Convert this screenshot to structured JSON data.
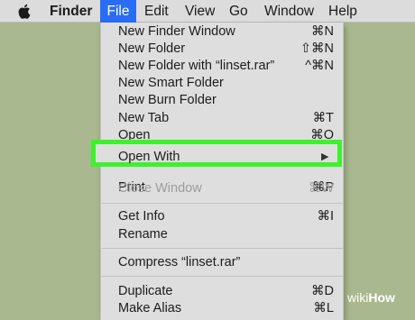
{
  "menubar": {
    "items": [
      "Finder",
      "File",
      "Edit",
      "View",
      "Go",
      "Window",
      "Help"
    ]
  },
  "file_menu": {
    "items": [
      {
        "label": "New Finder Window",
        "shortcut": "⌘N"
      },
      {
        "label": "New Folder",
        "shortcut": "⇧⌘N"
      },
      {
        "label": "New Folder with “linset.rar”",
        "shortcut": "^⌘N"
      },
      {
        "label": "New Smart Folder",
        "shortcut": ""
      },
      {
        "label": "New Burn Folder",
        "shortcut": ""
      },
      {
        "label": "New Tab",
        "shortcut": "⌘T"
      },
      {
        "label": "Open",
        "shortcut": "⌘O"
      },
      {
        "label": "Open With",
        "shortcut": "▶"
      },
      {
        "label": "Print",
        "shortcut": "⌘P"
      },
      {
        "label": "Close Window",
        "shortcut": "⌘W"
      },
      {
        "label": "Get Info",
        "shortcut": "⌘I"
      },
      {
        "label": "Rename",
        "shortcut": ""
      },
      {
        "label": "Compress “linset.rar”",
        "shortcut": ""
      },
      {
        "label": "Duplicate",
        "shortcut": "⌘D"
      },
      {
        "label": "Make Alias",
        "shortcut": "⌘L"
      }
    ]
  },
  "watermark": {
    "wiki": "wiki",
    "how": "How"
  },
  "colors": {
    "highlight": "#3cf22b",
    "selected_menu": "#2a6df4",
    "desktop": "#a9b88e"
  }
}
